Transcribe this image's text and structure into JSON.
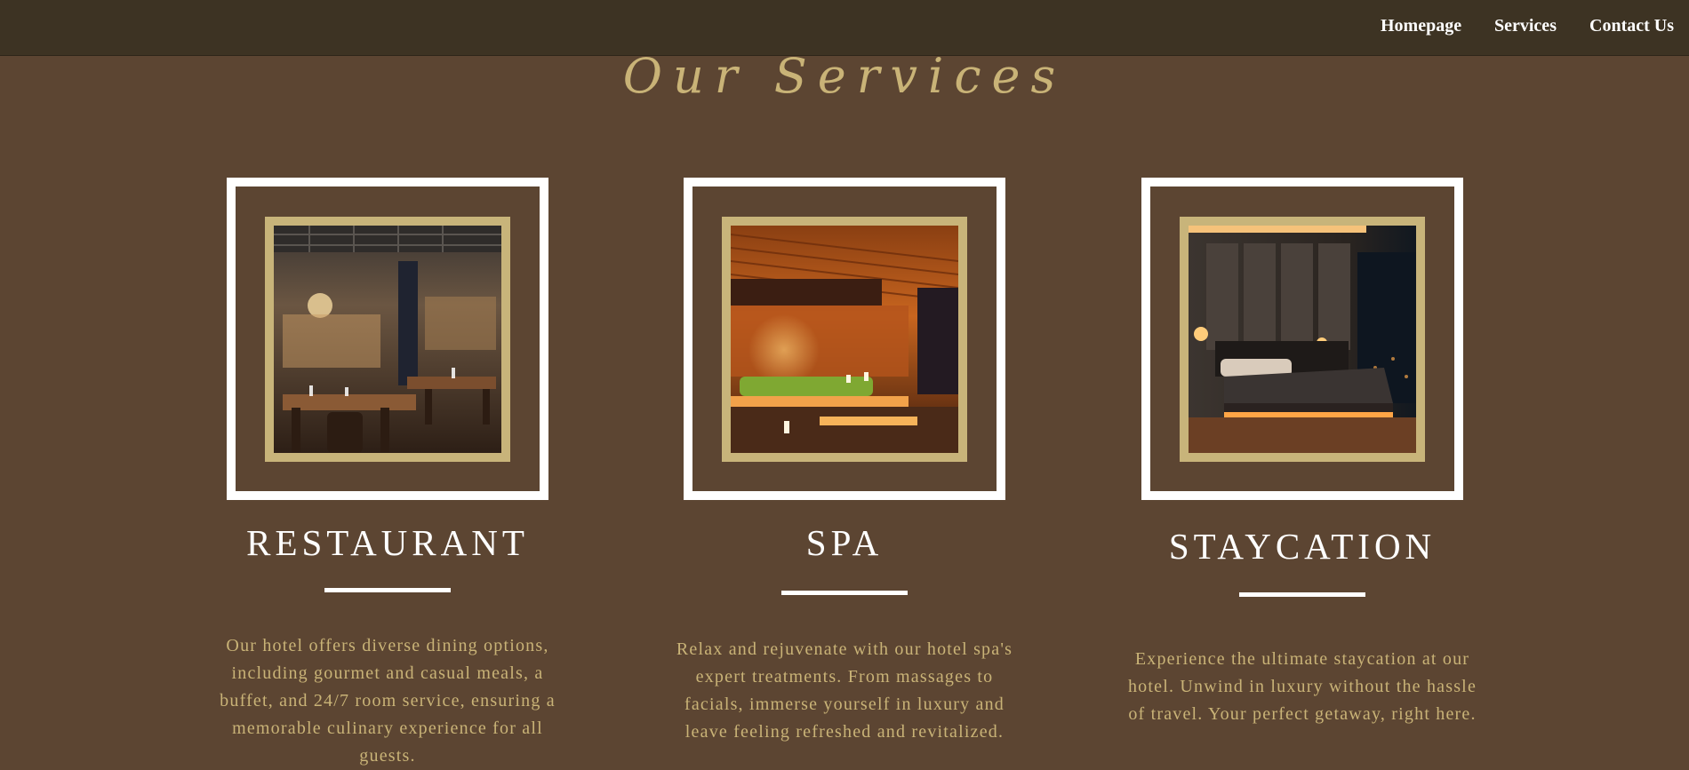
{
  "nav": {
    "home_label": "Homepage",
    "services_label": "Services",
    "contact_label": "Contact Us"
  },
  "section": {
    "title": "Our Services"
  },
  "services": [
    {
      "title": "RESTAURANT",
      "description": "Our hotel offers diverse dining options, including gourmet and casual meals, a buffet, and 24/7 room service, ensuring a memorable culinary experience for all guests.",
      "image": "restaurant-interior-photo"
    },
    {
      "title": "SPA",
      "description": "Relax and rejuvenate with our hotel spa's expert treatments. From massages to facials, immerse yourself in luxury and leave feeling refreshed and revitalized.",
      "image": "spa-room-photo"
    },
    {
      "title": "STAYCATION",
      "description": "Experience the ultimate staycation at our hotel. Unwind in luxury without the hassle of travel. Your perfect getaway, right here.",
      "image": "hotel-bedroom-photo"
    }
  ],
  "colors": {
    "background": "#5c4532",
    "navbar": "#3d3323",
    "accent_gold": "#c9b377",
    "frame_white": "#ffffff"
  }
}
